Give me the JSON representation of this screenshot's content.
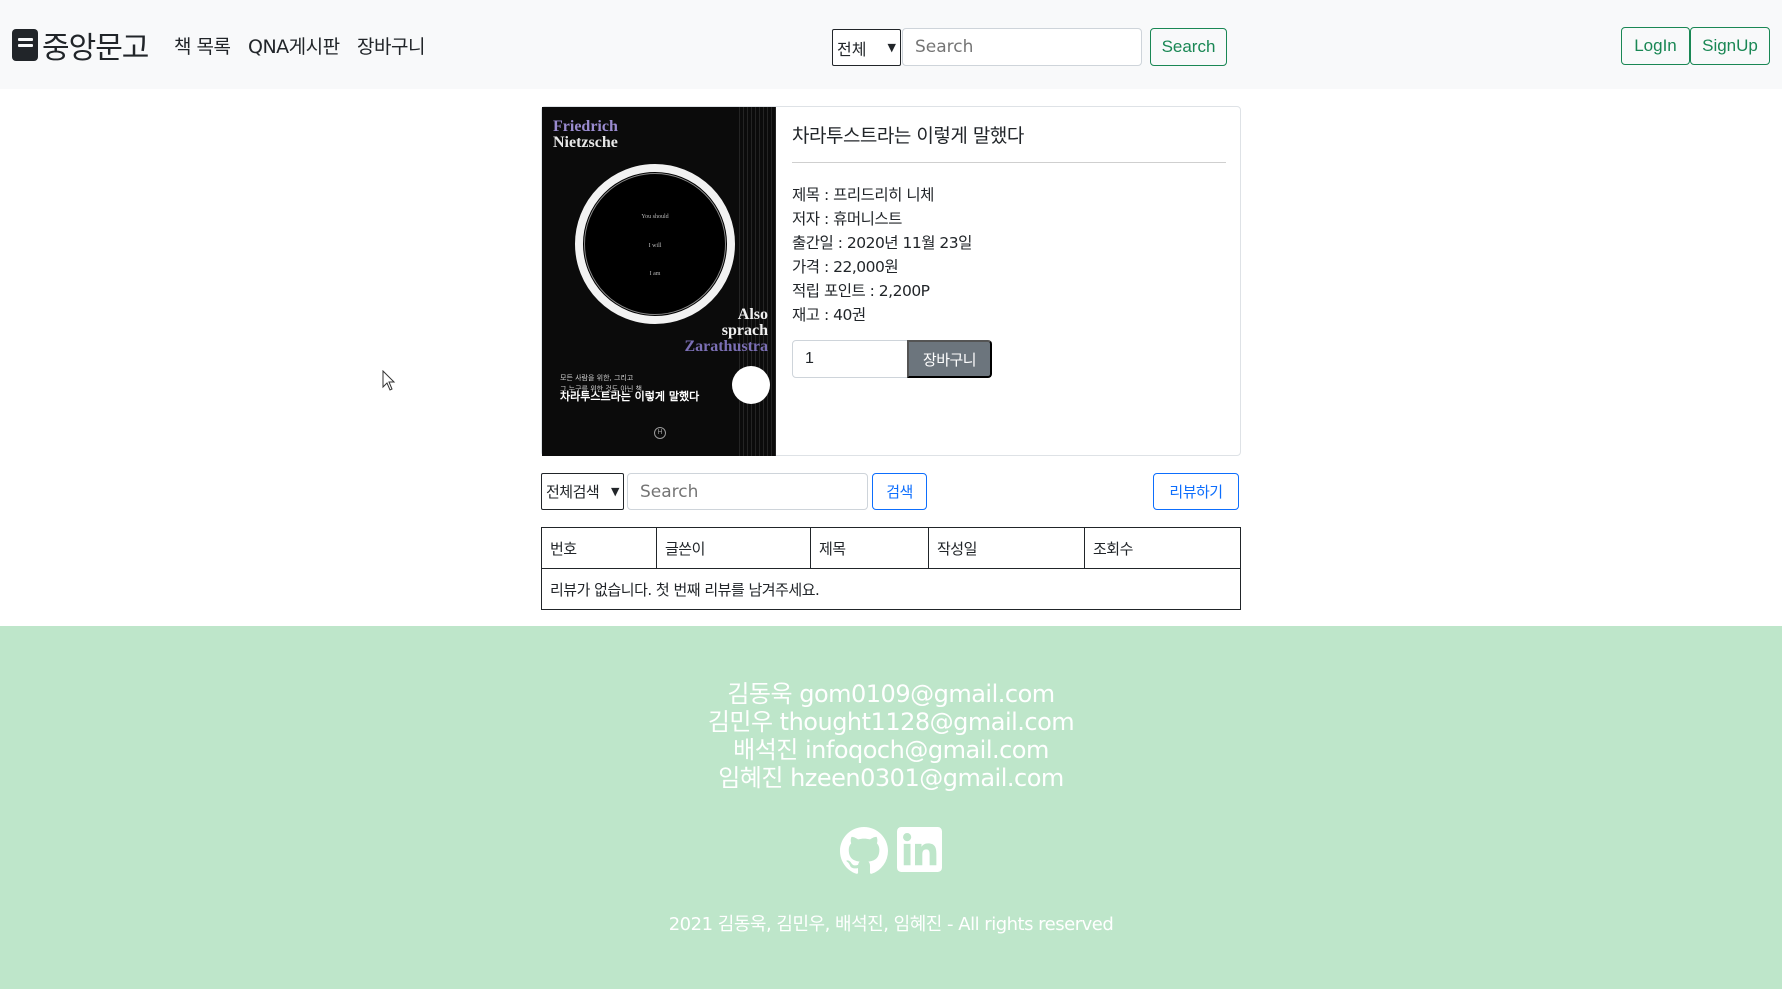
{
  "navbar": {
    "brand": "중앙문고",
    "links": [
      "책 목록",
      "QNA게시판",
      "장바구니"
    ],
    "search_select": "전체",
    "search_placeholder": "Search",
    "search_button": "Search",
    "login": "LogIn",
    "signup": "SignUp"
  },
  "book": {
    "heading": "차라투스트라는 이렇게 말했다",
    "info": [
      "제목 : 프리드리히 니체",
      "저자 : 휴머니스트",
      "출간일 : 2020년 11월 23일",
      "가격 : 22,000원",
      "적립 포인트 : 2,200P",
      "재고 : 40권"
    ],
    "quantity": "1",
    "cart_button": "장바구니",
    "cover": {
      "author_line1": "Friedrich",
      "author_line2": "Nietzsche",
      "ring_lines": [
        "You should",
        "I will",
        "I am"
      ],
      "title_line1": "Also",
      "title_line2": "sprach",
      "title_line3": "Zarathustra",
      "sub_line1": "모든 사람을 위한, 그리고",
      "sub_line2": "그 누구를 위한 것도 아닌 책",
      "korean_title": "차라투스트라는 이렇게 말했다"
    }
  },
  "reviews": {
    "select": "전체검색",
    "search_placeholder": "Search",
    "search_button": "검색",
    "write_button": "리뷰하기",
    "columns": [
      "번호",
      "글쓴이",
      "제목",
      "작성일",
      "조회수"
    ],
    "empty_message": "리뷰가 없습니다. 첫 번째 리뷰를 남겨주세요."
  },
  "footer": {
    "contacts": [
      "김동욱 gom0109@gmail.com",
      "김민우 thought1128@gmail.com",
      "배석진 infoqoch@gmail.com",
      "임혜진 hzeen0301@gmail.com"
    ],
    "copyright": "2021 김동욱, 김민우, 배석진, 임혜진 - All rights reserved"
  },
  "colors": {
    "success": "#198754",
    "primary": "#0d6efd",
    "secondary": "#6c757d",
    "footer_bg": "#bee6ca",
    "navbar_bg": "#f8f9fa"
  }
}
